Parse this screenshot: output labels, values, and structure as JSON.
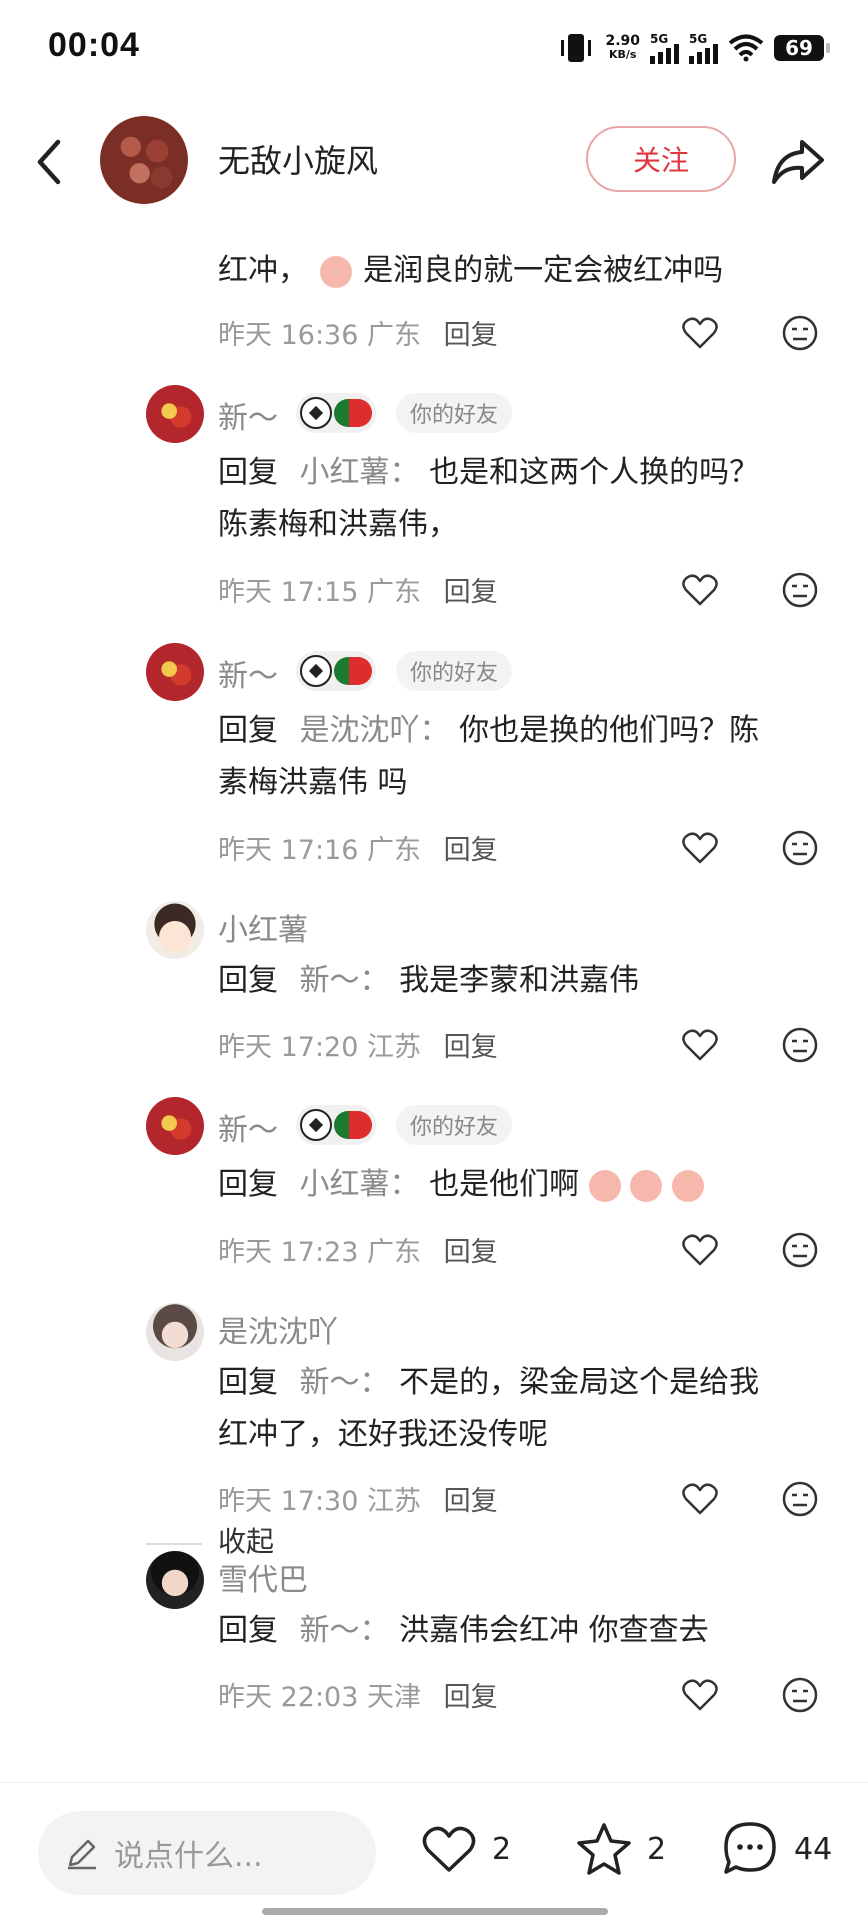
{
  "status_bar": {
    "time": "00:04",
    "net_speed_value": "2.90",
    "net_speed_unit": "KB/s",
    "signal1_label": "5G",
    "signal2_label": "5G",
    "battery": "69"
  },
  "header": {
    "title": "无敌小旋风",
    "follow_label": "关注"
  },
  "comments": [
    {
      "text_line1": "红冲，",
      "text_rest": "是润良的就一定会被红冲吗",
      "time": "昨天 16:36 广东",
      "reply_label": "回复"
    },
    {
      "username": "新～",
      "friend_tag": "你的好友",
      "reply_prefix": "回复",
      "reply_to": "小红薯：",
      "text1": "也是和这两个人换的吗？",
      "text2": "陈素梅和洪嘉伟，",
      "time": "昨天 17:15 广东",
      "reply_label": "回复"
    },
    {
      "username": "新～",
      "friend_tag": "你的好友",
      "reply_prefix": "回复",
      "reply_to": "是沈沈吖：",
      "text1": "你也是换的他们吗？陈",
      "text2": "素梅洪嘉伟 吗",
      "time": "昨天 17:16 广东",
      "reply_label": "回复"
    },
    {
      "username": "小红薯",
      "reply_prefix": "回复",
      "reply_to": "新～：",
      "text1": "我是李蒙和洪嘉伟",
      "time": "昨天 17:20 江苏",
      "reply_label": "回复"
    },
    {
      "username": "新～",
      "friend_tag": "你的好友",
      "reply_prefix": "回复",
      "reply_to": "小红薯：",
      "text1": "也是他们啊",
      "time": "昨天 17:23 广东",
      "reply_label": "回复"
    },
    {
      "username": "是沈沈吖",
      "reply_prefix": "回复",
      "reply_to": "新～：",
      "text1": "不是的，梁金局这个是给我",
      "text2": "红冲了，还好我还没传呢",
      "time": "昨天 17:30 江苏",
      "reply_label": "回复"
    },
    {
      "username": "雪代巴",
      "reply_prefix": "回复",
      "reply_to": "新～：",
      "text1": "洪嘉伟会红冲 你查查去",
      "time": "昨天 22:03 天津",
      "reply_label": "回复"
    }
  ],
  "collapse_label": "收起",
  "bottom_bar": {
    "input_placeholder": "说点什么...",
    "likes": "2",
    "favorites": "2",
    "comments": "44"
  },
  "colors": {
    "accent": "#e2363f",
    "muted": "#8a8a8a"
  }
}
